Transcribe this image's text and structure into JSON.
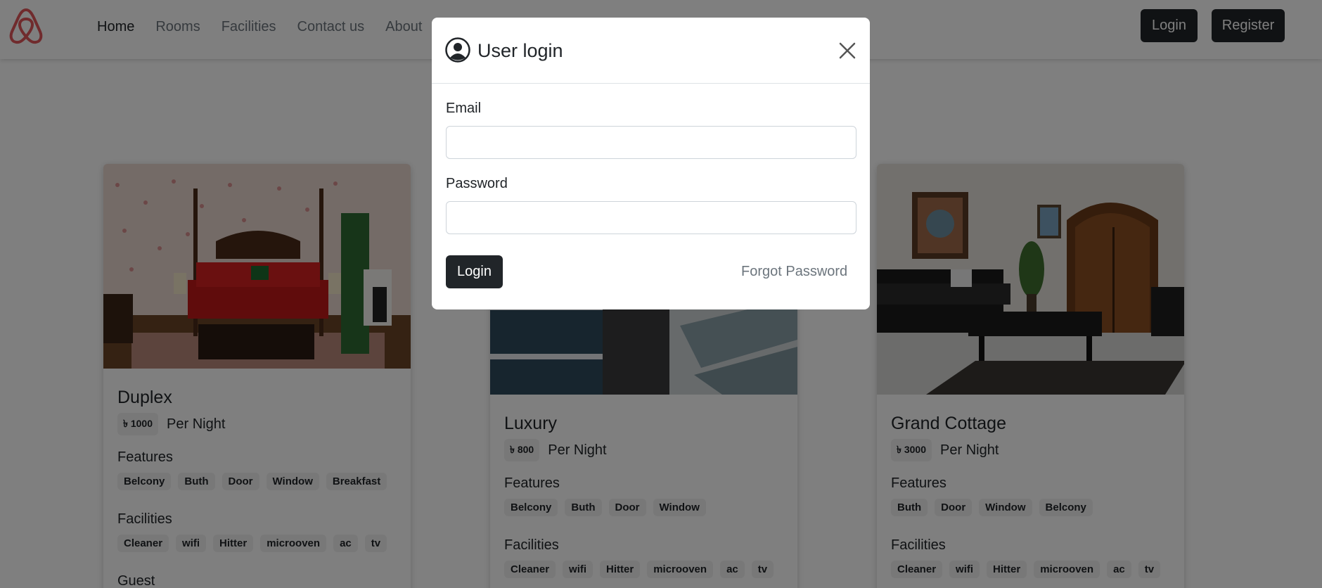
{
  "nav": {
    "logo_icon": "airbnb-logo-icon",
    "links": [
      "Home",
      "Rooms",
      "Facilities",
      "Contact us",
      "About"
    ],
    "login_label": "Login",
    "register_label": "Register"
  },
  "cards": [
    {
      "title": "Duplex",
      "price": "৳ 1000",
      "per_night": "Per Night",
      "features_title": "Features",
      "features": [
        "Belcony",
        "Buth",
        "Door",
        "Window",
        "Breakfast"
      ],
      "facilities_title": "Facilities",
      "facilities": [
        "Cleaner",
        "wifi",
        "Hitter",
        "microoven",
        "ac",
        "tv"
      ],
      "guest_title": "Guest"
    },
    {
      "title": "Luxury",
      "price": "৳ 800",
      "per_night": "Per Night",
      "features_title": "Features",
      "features": [
        "Belcony",
        "Buth",
        "Door",
        "Window"
      ],
      "facilities_title": "Facilities",
      "facilities": [
        "Cleaner",
        "wifi",
        "Hitter",
        "microoven",
        "ac",
        "tv"
      ]
    },
    {
      "title": "Grand Cottage",
      "price": "৳ 3000",
      "per_night": "Per Night",
      "features_title": "Features",
      "features": [
        "Buth",
        "Door",
        "Window",
        "Belcony"
      ],
      "facilities_title": "Facilities",
      "facilities": [
        "Cleaner",
        "wifi",
        "Hitter",
        "microoven",
        "ac",
        "tv"
      ]
    }
  ],
  "modal": {
    "title": "User login",
    "email_label": "Email",
    "email_value": "",
    "password_label": "Password",
    "password_value": "",
    "login_label": "Login",
    "forgot_label": "Forgot Password"
  }
}
